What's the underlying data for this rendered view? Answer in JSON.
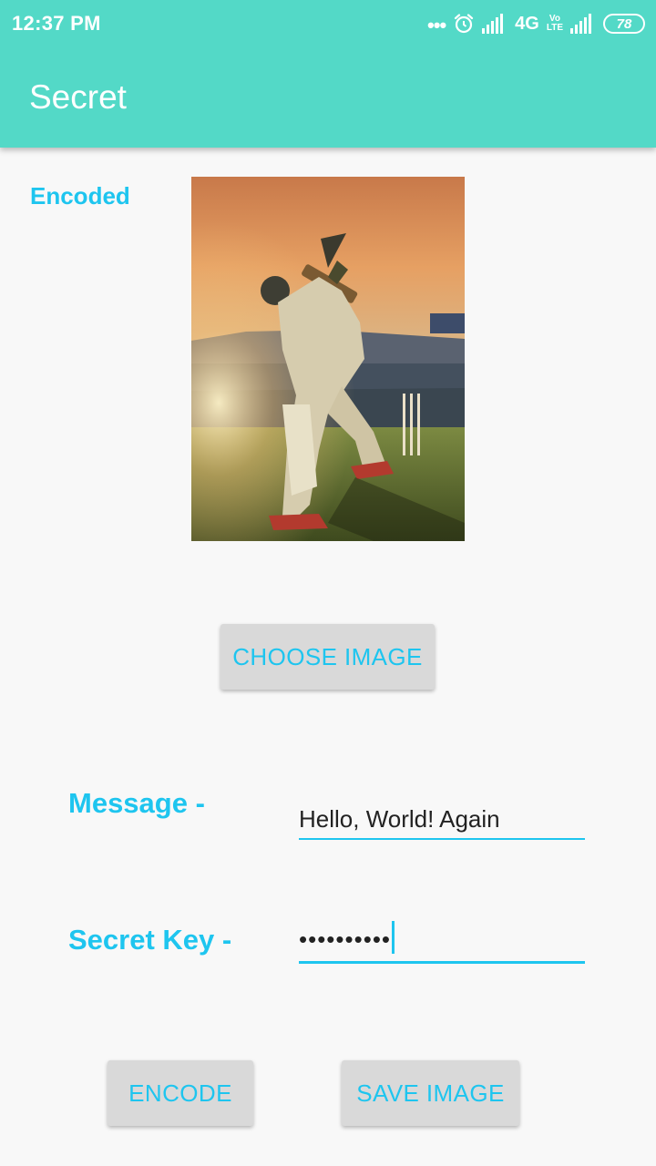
{
  "status_bar": {
    "time": "12:37 PM",
    "dots": "•••",
    "alarm_icon": "alarm-icon",
    "signal_icon": "signal-icon",
    "network": "4G",
    "volte": [
      "Vo",
      "LTE"
    ],
    "battery": "78"
  },
  "app_bar": {
    "title": "Secret"
  },
  "preview": {
    "label": "Encoded",
    "image_subject": "cricket batsman on stadium pitch at sunset"
  },
  "buttons": {
    "choose_image": "CHOOSE IMAGE",
    "encode": "ENCODE",
    "save_image": "SAVE IMAGE"
  },
  "form": {
    "message_label": "Message -",
    "message_value": "Hello, World!  Again",
    "secret_key_label": "Secret Key -",
    "secret_key_value": "••••••••••"
  },
  "colors": {
    "app_bar": "#53d9c7",
    "accent": "#1ec5ef",
    "button_bg": "#d9d9d9",
    "background": "#f8f8f8"
  }
}
